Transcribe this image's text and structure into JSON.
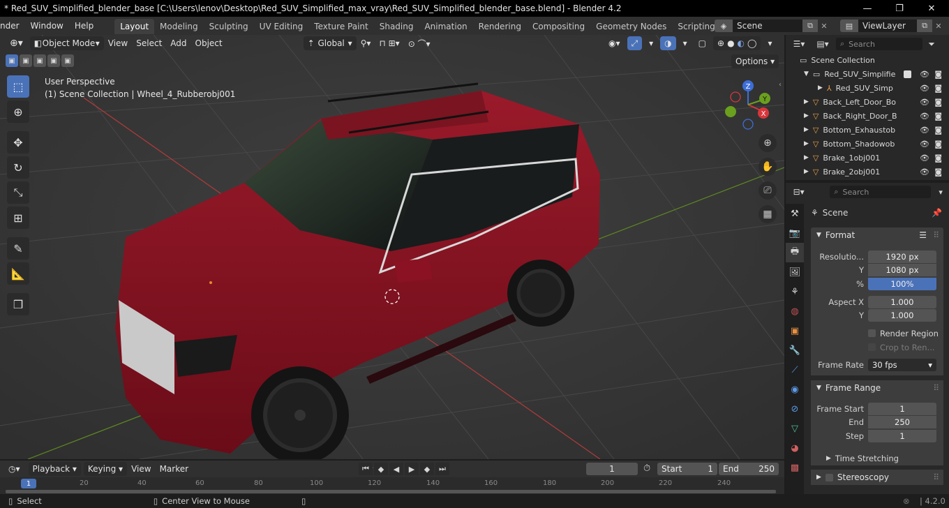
{
  "window": {
    "title": "* Red_SUV_Simplified_blender_base [C:\\Users\\lenov\\Desktop\\Red_SUV_Simplified_max_vray\\Red_SUV_Simplified_blender_base.blend] - Blender 4.2",
    "minimize": "—",
    "maximize": "❐",
    "close": "✕"
  },
  "menu": {
    "items": [
      "nder",
      "Window",
      "Help"
    ],
    "workspaces": [
      "Layout",
      "Modeling",
      "Sculpting",
      "UV Editing",
      "Texture Paint",
      "Shading",
      "Animation",
      "Rendering",
      "Compositing",
      "Geometry Nodes",
      "Scripting"
    ],
    "active_workspace": "Layout",
    "add_tab": "+",
    "scene": "Scene",
    "view_layer": "ViewLayer"
  },
  "viewport": {
    "mode": "Object Mode",
    "menus": [
      "View",
      "Select",
      "Add",
      "Object"
    ],
    "orientation": "Global",
    "options": "Options",
    "perspective": "User Perspective",
    "collection_info": "(1) Scene Collection | Wheel_4_Rubberobj001",
    "gizmo": {
      "z": "Z",
      "y": "Y",
      "x": "X"
    }
  },
  "outliner": {
    "search_placeholder": "Search",
    "root": "Scene Collection",
    "rows": [
      {
        "label": "Red_SUV_Simplifie",
        "type": "collection"
      },
      {
        "label": "Red_SUV_Simp",
        "type": "armature"
      },
      {
        "label": "Back_Left_Door_Bo",
        "type": "mesh"
      },
      {
        "label": "Back_Right_Door_B",
        "type": "mesh"
      },
      {
        "label": "Bottom_Exhaustob",
        "type": "mesh"
      },
      {
        "label": "Bottom_Shadowob",
        "type": "mesh"
      },
      {
        "label": "Brake_1obj001",
        "type": "mesh"
      },
      {
        "label": "Brake_2obj001",
        "type": "mesh"
      }
    ]
  },
  "properties": {
    "search_placeholder": "Search",
    "context": "Scene",
    "format": {
      "title": "Format",
      "resolution_label": "Resolutio...",
      "resolution_x": "1920 px",
      "y_label": "Y",
      "resolution_y": "1080 px",
      "percent_label": "%",
      "percent": "100%",
      "aspect_label": "Aspect X",
      "aspect_x": "1.000",
      "aspect_y": "1.000",
      "render_region": "Render Region",
      "crop": "Crop to Ren...",
      "frame_rate_label": "Frame Rate",
      "frame_rate": "30 fps"
    },
    "frame_range": {
      "title": "Frame Range",
      "start_label": "Frame Start",
      "start": "1",
      "end_label": "End",
      "end": "250",
      "step_label": "Step",
      "step": "1"
    },
    "time_stretching": "Time Stretching",
    "stereoscopy": "Stereoscopy"
  },
  "timeline": {
    "menus": [
      "Playback",
      "Keying",
      "View",
      "Marker"
    ],
    "current_frame": "1",
    "start_label": "Start",
    "start": "1",
    "end_label": "End",
    "end": "250",
    "ruler": [
      "1",
      "20",
      "40",
      "60",
      "80",
      "100",
      "120",
      "140",
      "160",
      "180",
      "200",
      "220",
      "240"
    ]
  },
  "status": {
    "select": "Select",
    "center": "Center View to Mouse",
    "version": "4.2.0"
  },
  "colors": {
    "accent": "#4a72b8",
    "car_body": "#8a1020",
    "x_axis": "#d8363b",
    "y_axis": "#6aa01e",
    "z_axis": "#3d6ed8"
  }
}
